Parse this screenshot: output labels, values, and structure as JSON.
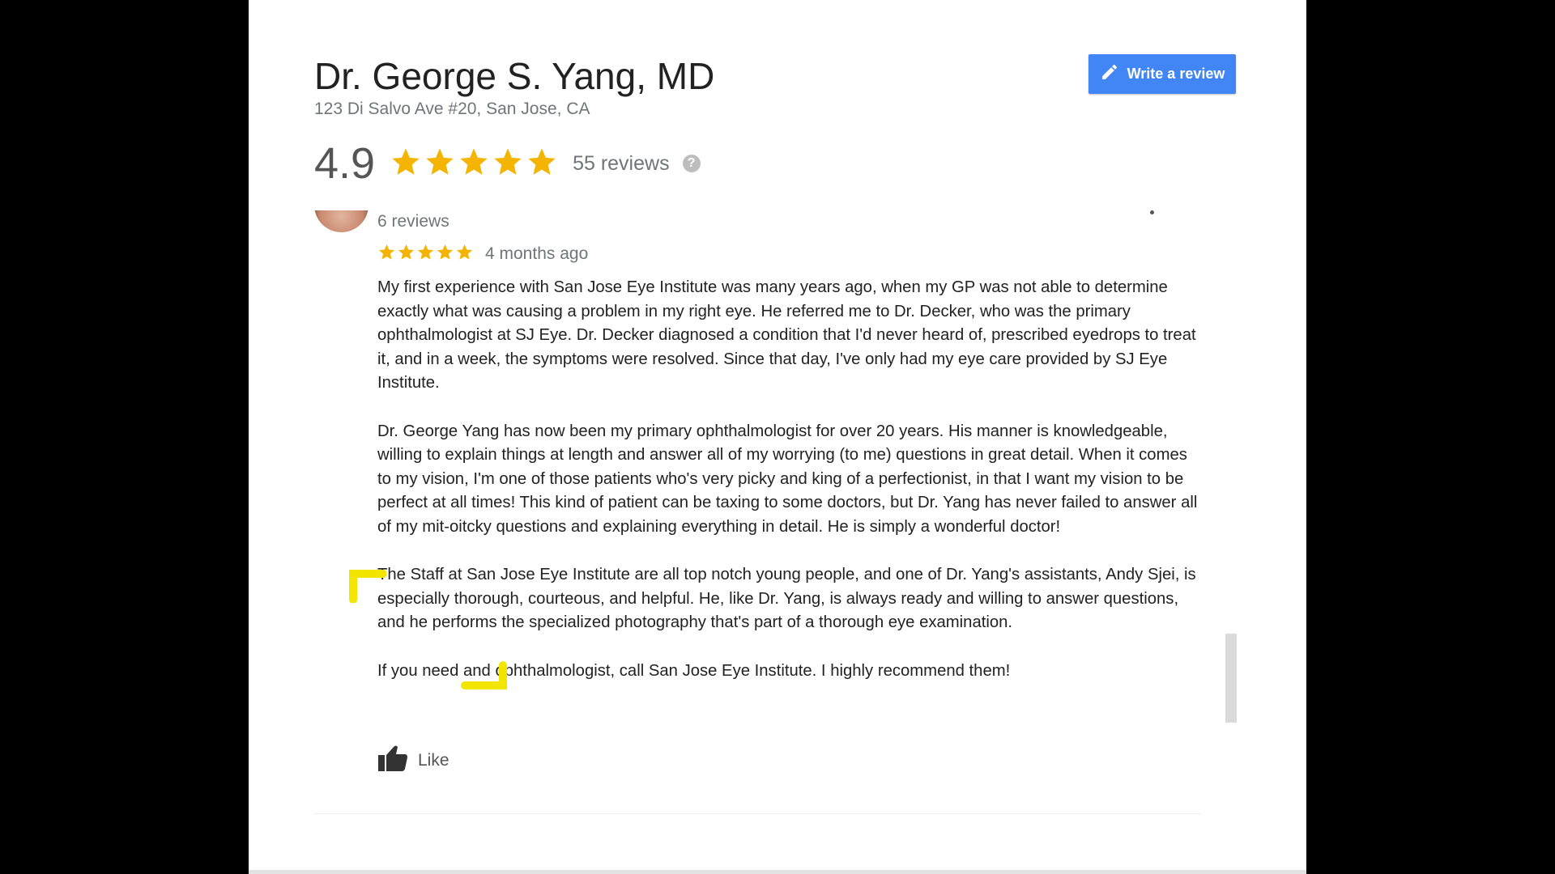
{
  "doctor": {
    "name": "Dr. George S. Yang, MD",
    "address": "123 Di Salvo Ave #20, San Jose, CA"
  },
  "write_review": {
    "label": "Write a review",
    "icon": "pencil-icon"
  },
  "summary": {
    "rating": "4.9",
    "stars": 5,
    "reviews_label": "55 reviews",
    "help_icon": "?"
  },
  "review": {
    "reviewer_reviews": "6 reviews",
    "stars": 5,
    "date": "4 months ago",
    "paragraphs": [
      "My first experience with San Jose Eye Institute was many years ago, when my GP was not able to determine exactly what was causing a problem in my right eye. He referred me to Dr. Decker, who was the primary ophthalmologist at SJ Eye. Dr. Decker diagnosed a condition that I'd never heard of, prescribed eyedrops to treat it, and in a week, the symptoms were resolved. Since that day, I've only had my eye care provided by SJ Eye Institute.",
      "Dr. George Yang has now been my primary ophthalmologist for over 20 years. His manner is knowledgeable, willing to explain things at length and answer all of my worrying (to me) questions in great detail. When it comes to my vision, I'm one of those patients who's very picky and king of a perfectionist, in that I want my vision to be perfect at all times! This kind of patient can be taxing to some doctors, but Dr. Yang has never failed to answer all of my mit-oitcky questions and explaining everything in detail. He is simply a wonderful doctor!",
      "The Staff at San Jose Eye Institute are all top notch young people, and one of Dr. Yang's assistants, Andy Sjei, is especially thorough, courteous, and helpful. He, like Dr. Yang, is always ready and willing to answer questions, and he performs the specialized photography that's part of a thorough eye examination.",
      "If you need and ophthalmologist, call San Jose Eye Institute. I highly recommend them!"
    ],
    "like_label": "Like"
  },
  "colors": {
    "star": "#f4b400",
    "button": "#4285f4",
    "highlight": "#f2e600"
  }
}
